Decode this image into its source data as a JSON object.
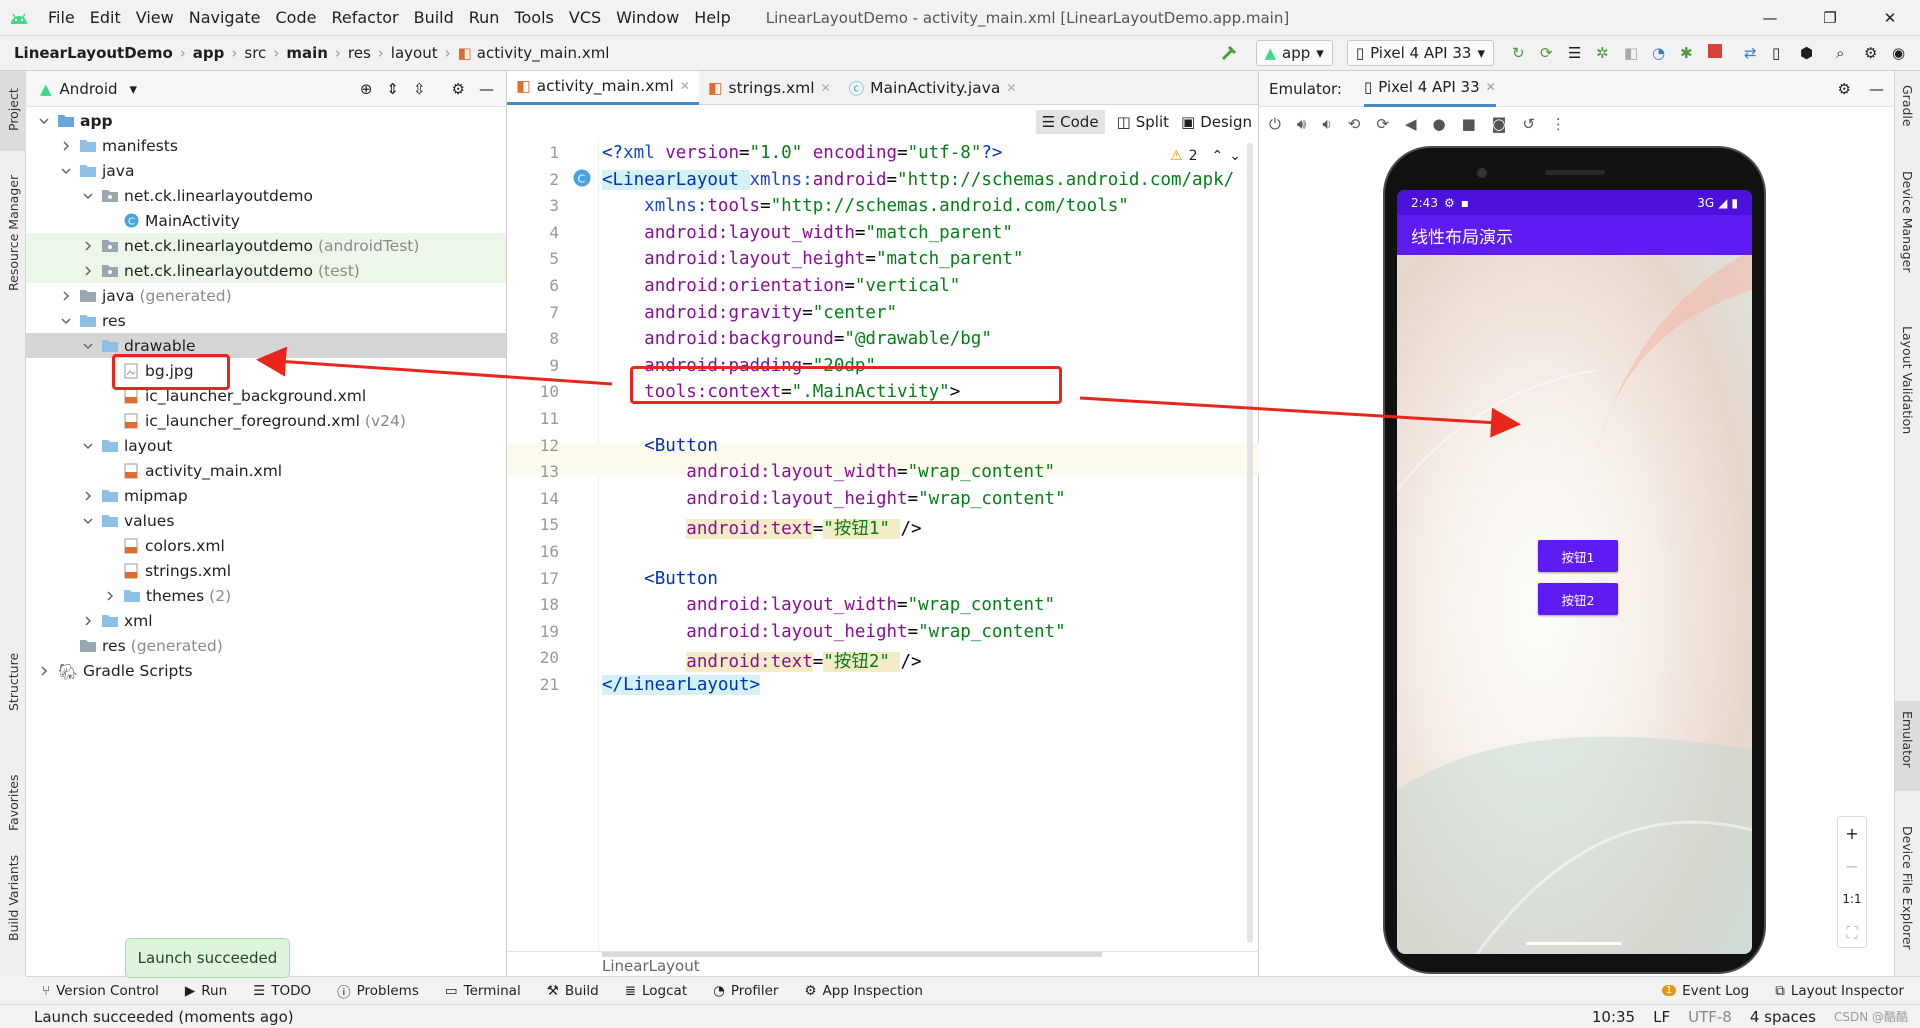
{
  "menu": {
    "items": [
      "File",
      "Edit",
      "View",
      "Navigate",
      "Code",
      "Refactor",
      "Build",
      "Run",
      "Tools",
      "VCS",
      "Window",
      "Help"
    ],
    "title": "LinearLayoutDemo - activity_main.xml [LinearLayoutDemo.app.main]"
  },
  "breadcrumb": [
    "LinearLayoutDemo",
    "app",
    "src",
    "main",
    "res",
    "layout",
    "activity_main.xml"
  ],
  "toolbar": {
    "run_config": "app",
    "device": "Pixel 4 API 33"
  },
  "left_strip": {
    "project": "Project",
    "resource_manager": "Resource Manager",
    "structure": "Structure",
    "favorites": "Favorites",
    "build_variants": "Build Variants"
  },
  "right_strip": {
    "gradle": "Gradle",
    "device_manager": "Device Manager",
    "layout_validation": "Layout Validation",
    "emulator": "Emulator",
    "device_file_explorer": "Device File Explorer"
  },
  "project": {
    "view": "Android",
    "tree": [
      {
        "label": "app",
        "suffix": ""
      },
      {
        "label": "manifests",
        "suffix": ""
      },
      {
        "label": "java",
        "suffix": ""
      },
      {
        "label": "net.ck.linearlayoutdemo",
        "suffix": ""
      },
      {
        "label": "MainActivity",
        "suffix": ""
      },
      {
        "label": "net.ck.linearlayoutdemo",
        "suffix": "(androidTest)"
      },
      {
        "label": "net.ck.linearlayoutdemo",
        "suffix": "(test)"
      },
      {
        "label": "java",
        "suffix": "(generated)"
      },
      {
        "label": "res",
        "suffix": ""
      },
      {
        "label": "drawable",
        "suffix": ""
      },
      {
        "label": "bg.jpg",
        "suffix": ""
      },
      {
        "label": "ic_launcher_background.xml",
        "suffix": ""
      },
      {
        "label": "ic_launcher_foreground.xml",
        "suffix": "(v24)"
      },
      {
        "label": "layout",
        "suffix": ""
      },
      {
        "label": "activity_main.xml",
        "suffix": ""
      },
      {
        "label": "mipmap",
        "suffix": ""
      },
      {
        "label": "values",
        "suffix": ""
      },
      {
        "label": "colors.xml",
        "suffix": ""
      },
      {
        "label": "strings.xml",
        "suffix": ""
      },
      {
        "label": "themes",
        "suffix": "(2)"
      },
      {
        "label": "xml",
        "suffix": ""
      },
      {
        "label": "res",
        "suffix": "(generated)"
      },
      {
        "label": "Gradle Scripts",
        "suffix": ""
      }
    ]
  },
  "editor": {
    "tabs": [
      "activity_main.xml",
      "strings.xml",
      "MainActivity.java"
    ],
    "modes": [
      "Code",
      "Split",
      "Design"
    ],
    "warnings": "2",
    "footer": "LinearLayout",
    "lines": [
      [
        [
          "tag",
          "<?"
        ],
        [
          "ns",
          "xml "
        ],
        [
          "attr",
          "version"
        ],
        [
          "txt",
          "="
        ],
        [
          "val",
          "\"1.0\" "
        ],
        [
          "attr",
          "encoding"
        ],
        [
          "txt",
          "="
        ],
        [
          "val",
          "\"utf-8\""
        ],
        [
          "tag",
          "?>"
        ]
      ],
      [
        [
          "tag",
          "<LinearLayout "
        ],
        [
          "ns",
          "xmlns:"
        ],
        [
          "attr",
          "android"
        ],
        [
          "txt",
          "="
        ],
        [
          "val",
          "\"http://schemas.android.com/apk/"
        ]
      ],
      [
        [
          "txt",
          "    "
        ],
        [
          "ns",
          "xmlns:"
        ],
        [
          "attr",
          "tools"
        ],
        [
          "txt",
          "="
        ],
        [
          "val",
          "\"http://schemas.android.com/tools\""
        ]
      ],
      [
        [
          "txt",
          "    "
        ],
        [
          "attr",
          "android:layout_width"
        ],
        [
          "txt",
          "="
        ],
        [
          "val",
          "\"match_parent\""
        ]
      ],
      [
        [
          "txt",
          "    "
        ],
        [
          "attr",
          "android:layout_height"
        ],
        [
          "txt",
          "="
        ],
        [
          "val",
          "\"match_parent\""
        ]
      ],
      [
        [
          "txt",
          "    "
        ],
        [
          "attr",
          "android:orientation"
        ],
        [
          "txt",
          "="
        ],
        [
          "val",
          "\"vertical\""
        ]
      ],
      [
        [
          "txt",
          "    "
        ],
        [
          "attr",
          "android:gravity"
        ],
        [
          "txt",
          "="
        ],
        [
          "val",
          "\"center\""
        ]
      ],
      [
        [
          "txt",
          "    "
        ],
        [
          "attr",
          "android:background"
        ],
        [
          "txt",
          "="
        ],
        [
          "val",
          "\"@drawable/bg\""
        ]
      ],
      [
        [
          "txt",
          "    "
        ],
        [
          "attr",
          "android:padding"
        ],
        [
          "txt",
          "="
        ],
        [
          "val",
          "\"20dp\""
        ]
      ],
      [
        [
          "txt",
          "    "
        ],
        [
          "attr",
          "tools:context"
        ],
        [
          "txt",
          "="
        ],
        [
          "val",
          "\".MainActivity\""
        ],
        [
          "txt",
          ">"
        ]
      ],
      [
        [
          "txt",
          ""
        ]
      ],
      [
        [
          "txt",
          "    "
        ],
        [
          "tag",
          "<Button"
        ]
      ],
      [
        [
          "txt",
          "        "
        ],
        [
          "attr",
          "android:layout_width"
        ],
        [
          "txt",
          "="
        ],
        [
          "val",
          "\"wrap_content\""
        ]
      ],
      [
        [
          "txt",
          "        "
        ],
        [
          "attr",
          "android:layout_height"
        ],
        [
          "txt",
          "="
        ],
        [
          "val",
          "\"wrap_content\""
        ]
      ],
      [
        [
          "txt",
          "        "
        ],
        [
          "attr",
          "android:text"
        ],
        [
          "txt",
          "="
        ],
        [
          "val",
          "\"按钮1\" "
        ],
        [
          "txt",
          "/>"
        ]
      ],
      [
        [
          "txt",
          ""
        ]
      ],
      [
        [
          "txt",
          "    "
        ],
        [
          "tag",
          "<Button"
        ]
      ],
      [
        [
          "txt",
          "        "
        ],
        [
          "attr",
          "android:layout_width"
        ],
        [
          "txt",
          "="
        ],
        [
          "val",
          "\"wrap_content\""
        ]
      ],
      [
        [
          "txt",
          "        "
        ],
        [
          "attr",
          "android:layout_height"
        ],
        [
          "txt",
          "="
        ],
        [
          "val",
          "\"wrap_content\""
        ]
      ],
      [
        [
          "txt",
          "        "
        ],
        [
          "attr",
          "android:text"
        ],
        [
          "txt",
          "="
        ],
        [
          "val",
          "\"按钮2\" "
        ],
        [
          "txt",
          "/>"
        ]
      ],
      [
        [
          "tag",
          "</LinearLayout>"
        ]
      ]
    ]
  },
  "emulator": {
    "label": "Emulator:",
    "device_tab": "Pixel 4 API 33",
    "time": "2:43",
    "network": "3G",
    "app_title": "线性布局演示",
    "button1": "按钮1",
    "button2": "按钮2"
  },
  "bottom_tools": [
    "Version Control",
    "Run",
    "TODO",
    "Problems",
    "Terminal",
    "Build",
    "Logcat",
    "Profiler",
    "App Inspection",
    "Event Log",
    "Layout Inspector"
  ],
  "event_count": "1",
  "toast": "Launch succeeded",
  "status": {
    "message": "Launch succeeded (moments ago)",
    "position": "10:35",
    "line_sep": "LF",
    "encoding": "UTF-8",
    "indent": "4 spaces",
    "watermark": "CSDN @酷酷"
  },
  "colors": {
    "accent": "#4a88c7",
    "app_purple": "#5e1bf2",
    "status_purple": "#4b10d9",
    "annotation_red": "#e8261c"
  }
}
